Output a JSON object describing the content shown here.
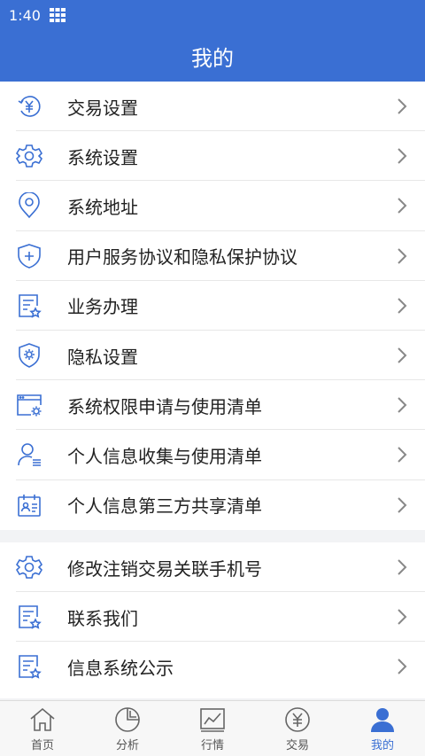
{
  "status": {
    "time": "1:40"
  },
  "header": {
    "title": "我的"
  },
  "menu_group_1": [
    {
      "label": "交易设置",
      "icon": "yuan-circle-icon"
    },
    {
      "label": "系统设置",
      "icon": "gear-icon"
    },
    {
      "label": "系统地址",
      "icon": "location-pin-icon"
    },
    {
      "label": "用户服务协议和隐私保护协议",
      "icon": "shield-plus-icon"
    },
    {
      "label": "业务办理",
      "icon": "document-star-icon"
    },
    {
      "label": "隐私设置",
      "icon": "shield-gear-icon"
    },
    {
      "label": "系统权限申请与使用清单",
      "icon": "window-gear-icon"
    },
    {
      "label": "个人信息收集与使用清单",
      "icon": "person-list-icon"
    },
    {
      "label": "个人信息第三方共享清单",
      "icon": "calendar-card-icon"
    }
  ],
  "menu_group_2": [
    {
      "label": "修改注销交易关联手机号",
      "icon": "gear-icon"
    },
    {
      "label": "联系我们",
      "icon": "document-star-icon"
    },
    {
      "label": "信息系统公示",
      "icon": "document-star-icon"
    }
  ],
  "tabs": [
    {
      "label": "首页",
      "icon": "home-icon",
      "active": false
    },
    {
      "label": "分析",
      "icon": "pie-chart-icon",
      "active": false
    },
    {
      "label": "行情",
      "icon": "line-chart-icon",
      "active": false
    },
    {
      "label": "交易",
      "icon": "yuan-circle-icon",
      "active": false
    },
    {
      "label": "我的",
      "icon": "user-icon",
      "active": true
    }
  ],
  "colors": {
    "primary": "#3a6fd3",
    "icon_blue": "#3a6fd3",
    "tab_gray": "#666666"
  }
}
